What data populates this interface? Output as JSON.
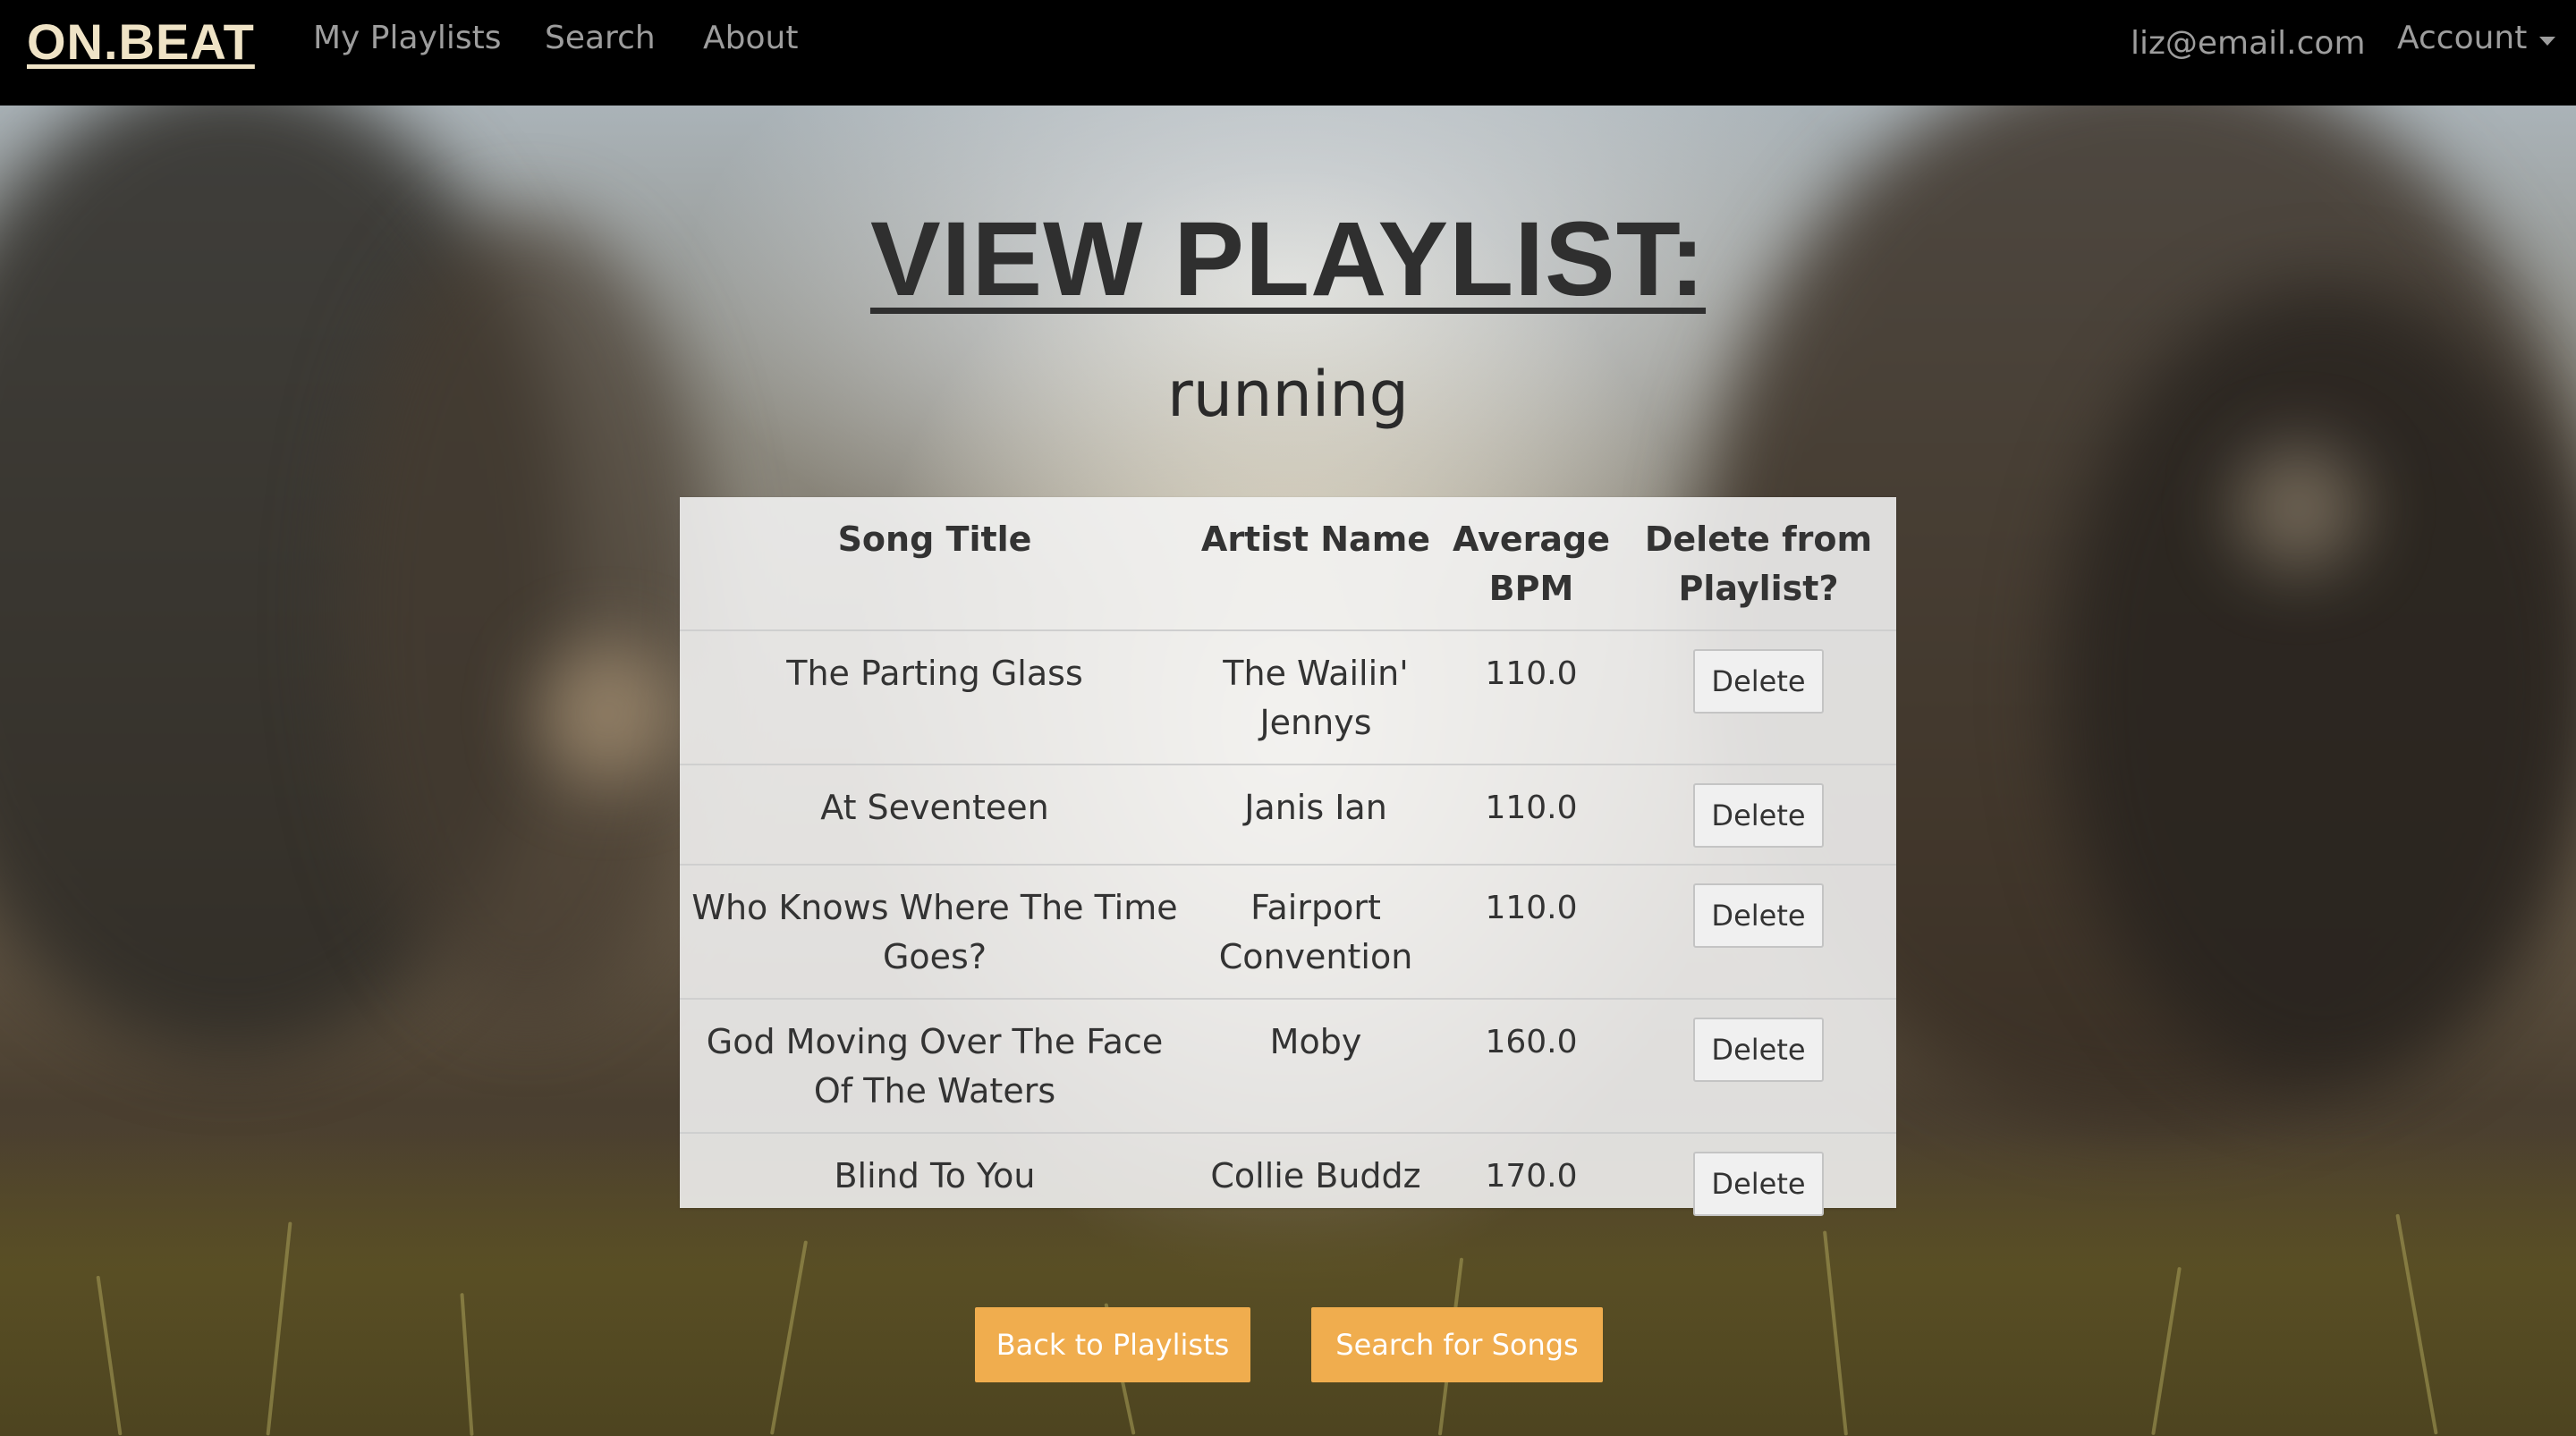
{
  "navbar": {
    "brand": "ON.BEAT",
    "links": [
      "My Playlists",
      "Search",
      "About"
    ],
    "user_email": "liz@email.com",
    "account_label": "Account"
  },
  "page": {
    "title": "VIEW PLAYLIST:",
    "playlist_name": "running"
  },
  "table": {
    "headers": {
      "song_title": "Song Title",
      "artist_name": "Artist Name",
      "average_bpm": "Average BPM",
      "delete": "Delete from Playlist?"
    },
    "rows": [
      {
        "title": "The Parting Glass",
        "artist": "The Wailin' Jennys",
        "bpm": "110.0",
        "delete_label": "Delete"
      },
      {
        "title": "At Seventeen",
        "artist": "Janis Ian",
        "bpm": "110.0",
        "delete_label": "Delete"
      },
      {
        "title": "Who Knows Where The Time Goes?",
        "artist": "Fairport Convention",
        "bpm": "110.0",
        "delete_label": "Delete"
      },
      {
        "title": "God Moving Over The Face Of The Waters",
        "artist": "Moby",
        "bpm": "160.0",
        "delete_label": "Delete"
      },
      {
        "title": "Blind To You",
        "artist": "Collie Buddz",
        "bpm": "170.0",
        "delete_label": "Delete"
      }
    ]
  },
  "actions": {
    "back_label": "Back to Playlists",
    "search_label": "Search for Songs"
  },
  "colors": {
    "navbar_bg": "#000000",
    "brand": "#efe3c6",
    "nav_link": "#9d9d9d",
    "action_button": "#f0ad4e"
  }
}
